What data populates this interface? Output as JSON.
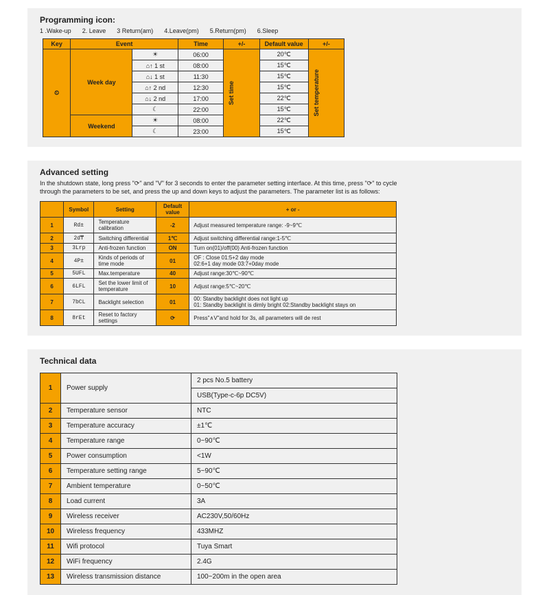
{
  "prog": {
    "title": "Programming icon:",
    "legend": [
      "1 .Wake-up",
      "2. Leave",
      "3 Return(am)",
      "4.Leave(pm)",
      "5.Return(pm)",
      "6.Sleep"
    ],
    "headers": [
      "Key",
      "Event",
      "",
      "Time",
      "+/-",
      "Default value",
      "+/-"
    ],
    "key_label": "⏲",
    "groups": [
      {
        "name": "Week day",
        "rows": [
          {
            "icon": "☀",
            "time": "06:00",
            "val": "20℃"
          },
          {
            "icon": "⌂↑ 1 st",
            "time": "08:00",
            "val": "15℃"
          },
          {
            "icon": "⌂↓ 1 st",
            "time": "11:30",
            "val": "15℃"
          },
          {
            "icon": "⌂↑ 2 nd",
            "time": "12:30",
            "val": "15℃"
          },
          {
            "icon": "⌂↓ 2 nd",
            "time": "17:00",
            "val": "22℃"
          },
          {
            "icon": "☾",
            "time": "22:00",
            "val": "15℃"
          }
        ]
      },
      {
        "name": "Weekend",
        "rows": [
          {
            "icon": "☀",
            "time": "08:00",
            "val": "22℃"
          },
          {
            "icon": "☾",
            "time": "23:00",
            "val": "15℃"
          }
        ]
      }
    ],
    "pm1": "Set time",
    "pm2": "Set temperature"
  },
  "adv": {
    "title": "Advanced setting",
    "desc": "In the shutdown state, long press \"⟳\" and \"V\" for 3 seconds to enter the parameter setting interface. At this time, press \"⟳\" to cycle through the parameters to be set, and press the up and down keys to adjust the parameters. The parameter list is as follows:",
    "headers": [
      "",
      "Symbol",
      "Setting",
      "Default value",
      "+ or -"
    ],
    "rows": [
      {
        "n": "1",
        "sym": "Rd±",
        "name": "Temperature calibration",
        "def": "-2",
        "desc": "Adjust measured temperature range: -9~9℃"
      },
      {
        "n": "2",
        "sym": "2d₸",
        "name": "Switching differential",
        "def": "1℃",
        "desc": "Adjust switching differential range:1-5℃"
      },
      {
        "n": "3",
        "sym": "3Lrp",
        "name": "Anti-frozen function",
        "def": "ON",
        "desc": "Turn on(01)/off(00) Anti-frozen function"
      },
      {
        "n": "4",
        "sym": "4P±",
        "name": "Kinds of periods of time mode",
        "def": "01",
        "desc": "OF : Close     01:5+2 day mode\n02:6+1 day mode     03:7+0day mode"
      },
      {
        "n": "5",
        "sym": "5UFL",
        "name": "Max.temperature",
        "def": "40",
        "desc": "Adjust range:30℃~90℃"
      },
      {
        "n": "6",
        "sym": "6LFL",
        "name": "Set the lower limit of temperature",
        "def": "10",
        "desc": "Adjust range:5℃~20℃"
      },
      {
        "n": "7",
        "sym": "7bCL",
        "name": "Backlight selection",
        "def": "01",
        "desc": "00: Standby backlight does not light up\n01: Standby backlight is dimly bright  02:Standby backlight stays on"
      },
      {
        "n": "8",
        "sym": "8rEt",
        "name": "Reset to factory settings",
        "def": "⟳",
        "desc": "Press\"∧V\"and hold for 3s, all parameters will de rest"
      }
    ]
  },
  "tech": {
    "title": "Technical data",
    "rows": [
      {
        "n": "1",
        "label": "Power supply",
        "vals": [
          "2 pcs No.5 battery",
          "USB(Type-c-6p DC5V)"
        ]
      },
      {
        "n": "2",
        "label": "Temperature sensor",
        "vals": [
          "NTC"
        ]
      },
      {
        "n": "3",
        "label": "Temperature accuracy",
        "vals": [
          "±1℃"
        ]
      },
      {
        "n": "4",
        "label": "Temperature range",
        "vals": [
          "0~90℃"
        ]
      },
      {
        "n": "5",
        "label": "Power consumption",
        "vals": [
          "<1W"
        ]
      },
      {
        "n": "6",
        "label": "Temperature setting range",
        "vals": [
          "5~90℃"
        ]
      },
      {
        "n": "7",
        "label": "Ambient temperature",
        "vals": [
          "0~50℃"
        ]
      },
      {
        "n": "8",
        "label": "Load current",
        "vals": [
          "3A"
        ]
      },
      {
        "n": "9",
        "label": "Wireless receiver",
        "vals": [
          "AC230V,50/60Hz"
        ]
      },
      {
        "n": "10",
        "label": "Wireless frequency",
        "vals": [
          "433MHZ"
        ]
      },
      {
        "n": "11",
        "label": "Wifi protocol",
        "vals": [
          "Tuya Smart"
        ]
      },
      {
        "n": "12",
        "label": "WiFi frequency",
        "vals": [
          "2.4G"
        ]
      },
      {
        "n": "13",
        "label": "Wireless transmission distance",
        "vals": [
          "100~200m in the open area"
        ]
      }
    ]
  }
}
